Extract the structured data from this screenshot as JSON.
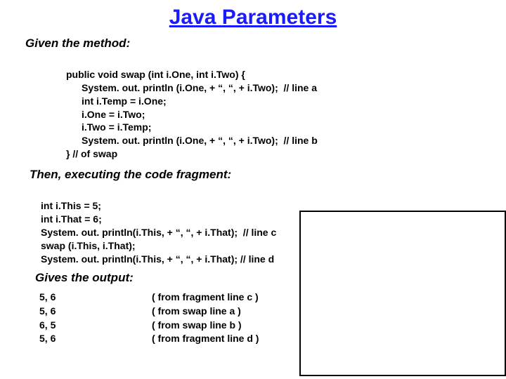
{
  "title": "Java Parameters",
  "labels": {
    "given": "Given the method:",
    "then": "Then, executing the code fragment:",
    "gives": "Gives the output:"
  },
  "method": {
    "line1": "public void swap (int i.One, int i.Two) {",
    "line2": "System. out. println (i.One, + “, “, + i.Two);  // line a",
    "line3": "int i.Temp = i.One;",
    "line4": "i.One = i.Two;",
    "line5": "i.Two = i.Temp;",
    "line6": "System. out. println (i.One, + “, “, + i.Two);  // line b",
    "line7": "} // of swap"
  },
  "fragment": {
    "line1": "int i.This = 5;",
    "line2": "int i.That = 6;",
    "line3": "System. out. println(i.This, + “, “, + i.That);  // line c",
    "line4": "swap (i.This, i.That);",
    "line5": "System. out. println(i.This, + “, “, + i.That); // line d"
  },
  "output": [
    {
      "value": "5, 6",
      "source": "( from fragment line c )"
    },
    {
      "value": "5, 6",
      "source": "( from swap       line a )"
    },
    {
      "value": "6, 5",
      "source": "( from swap       line b )"
    },
    {
      "value": "5, 6",
      "source": "( from fragment line d )"
    }
  ]
}
